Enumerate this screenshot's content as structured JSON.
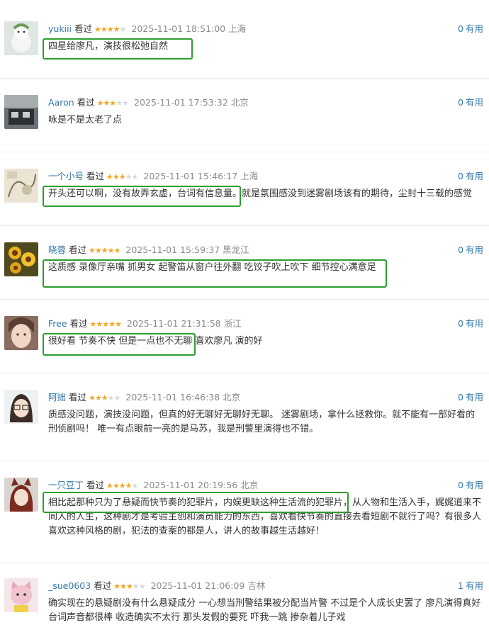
{
  "ui": {
    "seen_label": "看过",
    "useful_label": "有用"
  },
  "colors": {
    "username": "#3377aa",
    "star_on": "#f5a623",
    "star_off": "#d9d9d9",
    "highlight_box": "#2e9e2e",
    "meta_text": "#8a8a8a"
  },
  "comments": [
    {
      "user": "yukiii",
      "stars": 4,
      "time": "2025-11-01 18:51:00",
      "location": "上海",
      "useful_count": "0",
      "avatar": "snowman-avatar",
      "text": "四星给廖凡，演技很松弛自然"
    },
    {
      "user": "Aaron",
      "stars": 3,
      "time": "2025-11-01 17:53:32",
      "location": "北京",
      "useful_count": "0",
      "avatar": "train-photo-avatar",
      "text": "咏是不是太老了点"
    },
    {
      "user": "一个小号",
      "stars": 3,
      "time": "2025-11-01 15:46:17",
      "location": "上海",
      "useful_count": "0",
      "avatar": "sketch-avatar",
      "text": "开头还可以啊，没有故弄玄虚，台词有信息量。就是氛围感没到迷雾剧场该有的期待，尘封十三载的感觉"
    },
    {
      "user": "晓蓉",
      "stars": 5,
      "time": "2025-11-01 15:59:37",
      "location": "黑龙江",
      "useful_count": "0",
      "avatar": "sunflower-avatar",
      "text": "这质感 录像厅亲嘴 抓男女 起警笛从窗户往外翻 吃饺子吹上吹下 细节控心满意足"
    },
    {
      "user": "Free",
      "stars": 5,
      "time": "2025-11-01 21:31:58",
      "location": "浙江",
      "useful_count": "0",
      "avatar": "girl-face-avatar",
      "text": "很好看 节奏不快 但是一点也不无聊 喜欢廖凡 演的好"
    },
    {
      "user": "阿拙",
      "stars": 3,
      "time": "2025-11-01 16:46:38",
      "location": "北京",
      "useful_count": "0",
      "avatar": "cartoon-girl-avatar",
      "text": "质感没问题，演技没问题，但真的好无聊好无聊好无聊。 迷雾剧场，拿什么拯救你。就不能有一部好看的刑侦剧吗！ 唯一有点眼前一亮的是马苏，我是刑警里演得也不错。"
    },
    {
      "user": "一只豆丁",
      "stars": 4,
      "time": "2025-11-01 20:19:56",
      "location": "北京",
      "useful_count": "0",
      "avatar": "anime-fox-avatar",
      "text": "相比起那种只为了悬疑而快节奏的犯罪片，内娱更缺这种生活流的犯罪片，从人物和生活入手，娓娓道来不同人的人生，这种剧才是考验主创和演员能力的东西，喜欢看快节奏的直接去看短剧不就行了吗？有很多人喜欢这种风格的剧，犯法的查案的都是人，讲人的故事越生活越好！"
    },
    {
      "user": "_sue0603",
      "stars": 3,
      "time": "2025-11-01 21:06:09",
      "location": "吉林",
      "useful_count": "1",
      "avatar": "pink-cat-avatar",
      "text": "确实现在的悬疑剧没有什么悬疑成分 一心想当刑警结果被分配当片警 不过是个人成长史罢了 廖凡演得真好 台词声音都很棒 收造确实不太行 那头发假的要死 吓我一跳 掺杂着儿子戏"
    }
  ]
}
